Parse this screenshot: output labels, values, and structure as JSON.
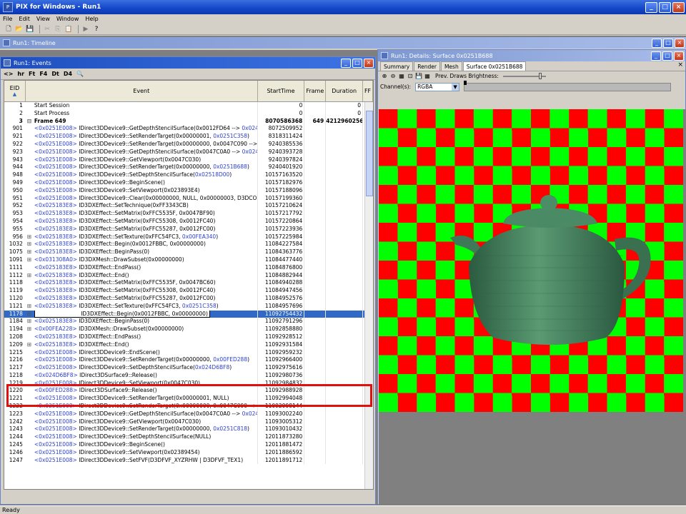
{
  "app": {
    "title": "PIX for Windows - Run1"
  },
  "menu": [
    "File",
    "Edit",
    "View",
    "Window",
    "Help"
  ],
  "timeline": {
    "title": "Run1: Timeline"
  },
  "events_window": {
    "title": "Run1: Events",
    "toolbar": [
      "<>",
      "hr",
      "Ft",
      "F4",
      "Dt",
      "D4"
    ],
    "columns": {
      "eid": "EID",
      "event": "Event",
      "start": "StartTime",
      "frame": "Frame",
      "duration": "Duration",
      "ff": "FF"
    }
  },
  "rows": [
    {
      "eid": "1",
      "ind": "",
      "ptr": "",
      "call": "Start Session",
      "arg": "",
      "arg2": "",
      "start": "0",
      "frame": "",
      "dur": "0"
    },
    {
      "eid": "2",
      "ind": "",
      "ptr": "",
      "call": "Start Process",
      "arg": "",
      "arg2": "",
      "start": "0",
      "frame": "",
      "dur": "0"
    },
    {
      "eid": "3",
      "ind": "⊟",
      "ptr": "",
      "call": "Frame 649",
      "arg": "",
      "arg2": "",
      "start": "8070586368",
      "frame": "649",
      "dur": "4212960256",
      "bold": true
    },
    {
      "eid": "901",
      "ind": "",
      "ptr": "<0x0251E008>",
      "call": " IDirect3DDevice9::GetDepthStencilSurface(0x0012FD64 --> ",
      "arg": "0x024C",
      "arg2": "",
      "start": "8072509952",
      "frame": "",
      "dur": ""
    },
    {
      "eid": "921",
      "ind": "",
      "ptr": "<0x0251E008>",
      "call": " IDirect3DDevice9::SetRenderTarget(0x00000001, ",
      "arg": "0x0251C358",
      "arg2": ")",
      "start": "8318311424",
      "frame": "",
      "dur": ""
    },
    {
      "eid": "922",
      "ind": "",
      "ptr": "<0x0251E008>",
      "call": " IDirect3DDevice9::SetRenderTarget(0x00000000, 0x0047C090 -->",
      "arg": "",
      "arg2": "",
      "start": "9240385536",
      "frame": "",
      "dur": ""
    },
    {
      "eid": "923",
      "ind": "",
      "ptr": "<0x0251E008>",
      "call": " IDirect3DDevice9::GetDepthStencilSurface(0x0047C0A0 --> ",
      "arg": "0x024C",
      "arg2": "",
      "start": "9240393728",
      "frame": "",
      "dur": ""
    },
    {
      "eid": "943",
      "ind": "",
      "ptr": "<0x0251E008>",
      "call": " IDirect3DDevice9::GetViewport(0x0047C030)",
      "arg": "",
      "arg2": "",
      "start": "9240397824",
      "frame": "",
      "dur": ""
    },
    {
      "eid": "944",
      "ind": "",
      "ptr": "<0x0251E008>",
      "call": " IDirect3DDevice9::SetRenderTarget(0x00000000, ",
      "arg": "0x0251B688",
      "arg2": ")",
      "start": "9240401920",
      "frame": "",
      "dur": ""
    },
    {
      "eid": "948",
      "ind": "",
      "ptr": "<0x0251E008>",
      "call": " IDirect3DDevice9::SetDepthStencilSurface(",
      "arg": "0x02518D00",
      "arg2": ")",
      "start": "10157163520",
      "frame": "",
      "dur": ""
    },
    {
      "eid": "949",
      "ind": "",
      "ptr": "<0x0251E008>",
      "call": " IDirect3DDevice9::BeginScene()",
      "arg": "",
      "arg2": "",
      "start": "10157182976",
      "frame": "",
      "dur": ""
    },
    {
      "eid": "950",
      "ind": "",
      "ptr": "<0x0251E008>",
      "call": " IDirect3DDevice9::SetViewport(0x023893E4)",
      "arg": "",
      "arg2": "",
      "start": "10157188096",
      "frame": "",
      "dur": ""
    },
    {
      "eid": "951",
      "ind": "",
      "ptr": "<0x0251E008>",
      "call": " IDirect3DDevice9::Clear(0x00000000, NULL, 0x00000003, D3DCOL",
      "arg": "",
      "arg2": "",
      "start": "10157199360",
      "frame": "",
      "dur": ""
    },
    {
      "eid": "952",
      "ind": "",
      "ptr": "<0x025183E8>",
      "call": " ID3DXEffect::SetTechnique(0xFF3343CB)",
      "arg": "",
      "arg2": "",
      "start": "10157210624",
      "frame": "",
      "dur": ""
    },
    {
      "eid": "953",
      "ind": "",
      "ptr": "<0x025183E8>",
      "call": " ID3DXEffect::SetMatrix(0xFFC5535F, 0x0047BF90)",
      "arg": "",
      "arg2": "",
      "start": "10157217792",
      "frame": "",
      "dur": ""
    },
    {
      "eid": "954",
      "ind": "",
      "ptr": "<0x025183E8>",
      "call": " ID3DXEffect::SetMatrix(0xFFC55308, 0x0012FC40)",
      "arg": "",
      "arg2": "",
      "start": "10157220864",
      "frame": "",
      "dur": ""
    },
    {
      "eid": "955",
      "ind": "",
      "ptr": "<0x025183E8>",
      "call": " ID3DXEffect::SetMatrix(0xFFC55287, 0x0012FC00)",
      "arg": "",
      "arg2": "",
      "start": "10157223936",
      "frame": "",
      "dur": ""
    },
    {
      "eid": "956",
      "ind": "⊞",
      "ptr": "<0x025183E8>",
      "call": " ID3DXEffect::SetTexture(0xFFC54FC3, ",
      "arg": "0x00FEA340",
      "arg2": ")",
      "start": "10157225984",
      "frame": "",
      "dur": ""
    },
    {
      "eid": "1032",
      "ind": "⊞",
      "ptr": "<0x025183E8>",
      "call": " ID3DXEffect::Begin(0x0012FBBC, 0x00000000)",
      "arg": "",
      "arg2": "",
      "start": "11084227584",
      "frame": "",
      "dur": ""
    },
    {
      "eid": "1075",
      "ind": "⊞",
      "ptr": "<0x025183E8>",
      "call": " ID3DXEffect::BeginPass(0)",
      "arg": "",
      "arg2": "",
      "start": "11084363776",
      "frame": "",
      "dur": ""
    },
    {
      "eid": "1091",
      "ind": "⊞",
      "ptr": "<0x031308A0>",
      "call": " ID3DXMesh::DrawSubset(0x00000000)",
      "arg": "",
      "arg2": "",
      "start": "11084477440",
      "frame": "",
      "dur": ""
    },
    {
      "eid": "1111",
      "ind": "",
      "ptr": "<0x025183E8>",
      "call": " ID3DXEffect::EndPass()",
      "arg": "",
      "arg2": "",
      "start": "11084876800",
      "frame": "",
      "dur": ""
    },
    {
      "eid": "1112",
      "ind": "⊞",
      "ptr": "<0x025183E8>",
      "call": " ID3DXEffect::End()",
      "arg": "",
      "arg2": "",
      "start": "11084882944",
      "frame": "",
      "dur": ""
    },
    {
      "eid": "1118",
      "ind": "",
      "ptr": "<0x025183E8>",
      "call": " ID3DXEffect::SetMatrix(0xFFC5535F, 0x0047BC60)",
      "arg": "",
      "arg2": "",
      "start": "11084940288",
      "frame": "",
      "dur": ""
    },
    {
      "eid": "1119",
      "ind": "",
      "ptr": "<0x025183E8>",
      "call": " ID3DXEffect::SetMatrix(0xFFC55308, 0x0012FC40)",
      "arg": "",
      "arg2": "",
      "start": "11084947456",
      "frame": "",
      "dur": ""
    },
    {
      "eid": "1120",
      "ind": "",
      "ptr": "<0x025183E8>",
      "call": " ID3DXEffect::SetMatrix(0xFFC55287, 0x0012FC00)",
      "arg": "",
      "arg2": "",
      "start": "11084952576",
      "frame": "",
      "dur": ""
    },
    {
      "eid": "1121",
      "ind": "⊞",
      "ptr": "<0x025183E8>",
      "call": " ID3DXEffect::SetTexture(0xFFC54FC3, ",
      "arg": "0x0251C358",
      "arg2": ")",
      "start": "11084957696",
      "frame": "",
      "dur": ""
    },
    {
      "eid": "1178",
      "ind": "⊞",
      "ptr": "<0x025183E8>",
      "call": " ID3DXEffect::Begin(0x0012FBBC, 0x00000000)",
      "arg": "",
      "arg2": "",
      "start": "11092754432",
      "frame": "",
      "dur": "",
      "selected": true
    },
    {
      "eid": "1184",
      "ind": "⊞",
      "ptr": "<0x025183E8>",
      "call": " ID3DXEffect::BeginPass(0)",
      "arg": "",
      "arg2": "",
      "start": "11092791296",
      "frame": "",
      "dur": ""
    },
    {
      "eid": "1194",
      "ind": "⊞",
      "ptr": "<0x00FEA228>",
      "call": " ID3DXMesh::DrawSubset(0x00000000)",
      "arg": "",
      "arg2": "",
      "start": "11092858880",
      "frame": "",
      "dur": ""
    },
    {
      "eid": "1208",
      "ind": "",
      "ptr": "<0x025183E8>",
      "call": " ID3DXEffect::EndPass()",
      "arg": "",
      "arg2": "",
      "start": "11092928512",
      "frame": "",
      "dur": ""
    },
    {
      "eid": "1209",
      "ind": "⊞",
      "ptr": "<0x025183E8>",
      "call": " ID3DXEffect::End()",
      "arg": "",
      "arg2": "",
      "start": "11092931584",
      "frame": "",
      "dur": ""
    },
    {
      "eid": "1215",
      "ind": "",
      "ptr": "<0x0251E008>",
      "call": " IDirect3DDevice9::EndScene()",
      "arg": "",
      "arg2": "",
      "start": "11092959232",
      "frame": "",
      "dur": ""
    },
    {
      "eid": "1216",
      "ind": "",
      "ptr": "<0x0251E008>",
      "call": " IDirect3DDevice9::SetRenderTarget(0x00000000, ",
      "arg": "0x00FED288",
      "arg2": ")",
      "start": "11092966400",
      "frame": "",
      "dur": ""
    },
    {
      "eid": "1217",
      "ind": "",
      "ptr": "<0x0251E008>",
      "call": " IDirect3DDevice9::SetDepthStencilSurface(",
      "arg": "0x024D6BF8",
      "arg2": ")",
      "start": "11092975616",
      "frame": "",
      "dur": ""
    },
    {
      "eid": "1218",
      "ind": "",
      "ptr": "<0x024D6BF8>",
      "call": " IDirect3DSurface9::Release()",
      "arg": "",
      "arg2": "",
      "start": "11092980736",
      "frame": "",
      "dur": ""
    },
    {
      "eid": "1219",
      "ind": "",
      "ptr": "<0x0251E008>",
      "call": " IDirect3DDevice9::SetViewport(0x0047C030)",
      "arg": "",
      "arg2": "",
      "start": "11092984832",
      "frame": "",
      "dur": ""
    },
    {
      "eid": "1220",
      "ind": "",
      "ptr": "<0x00FED288>",
      "call": " IDirect3DSurface9::Release()",
      "arg": "",
      "arg2": "",
      "start": "11092988928",
      "frame": "",
      "dur": ""
    },
    {
      "eid": "1221",
      "ind": "",
      "ptr": "<0x0251E008>",
      "call": " IDirect3DDevice9::SetRenderTarget(0x00000001, NULL)",
      "arg": "",
      "arg2": "",
      "start": "11092994048",
      "frame": "",
      "dur": ""
    },
    {
      "eid": "1222",
      "ind": "",
      "ptr": "<0x0251E008>",
      "call": " IDirect3DDevice9::SetRenderTarget(0x00000000, 0x0047C090 -->",
      "arg": "",
      "arg2": "",
      "start": "11092998144",
      "frame": "",
      "dur": ""
    },
    {
      "eid": "1223",
      "ind": "",
      "ptr": "<0x0251E008>",
      "call": " IDirect3DDevice9::GetDepthStencilSurface(0x0047C0A0 --> ",
      "arg": "0x024C",
      "arg2": "",
      "start": "11093002240",
      "frame": "",
      "dur": ""
    },
    {
      "eid": "1242",
      "ind": "",
      "ptr": "<0x0251E008>",
      "call": " IDirect3DDevice9::GetViewport(0x0047C030)",
      "arg": "",
      "arg2": "",
      "start": "11093005312",
      "frame": "",
      "dur": ""
    },
    {
      "eid": "1243",
      "ind": "",
      "ptr": "<0x0251E008>",
      "call": " IDirect3DDevice9::SetRenderTarget(0x00000000, ",
      "arg": "0x0251C818",
      "arg2": ")",
      "start": "11093010432",
      "frame": "",
      "dur": ""
    },
    {
      "eid": "1244",
      "ind": "",
      "ptr": "<0x0251E008>",
      "call": " IDirect3DDevice9::SetDepthStencilSurface(NULL)",
      "arg": "",
      "arg2": "",
      "start": "12011873280",
      "frame": "",
      "dur": ""
    },
    {
      "eid": "1245",
      "ind": "",
      "ptr": "<0x0251E008>",
      "call": " IDirect3DDevice9::BeginScene()",
      "arg": "",
      "arg2": "",
      "start": "12011881472",
      "frame": "",
      "dur": ""
    },
    {
      "eid": "1246",
      "ind": "",
      "ptr": "<0x0251E008>",
      "call": " IDirect3DDevice9::SetViewport(0x02389454)",
      "arg": "",
      "arg2": "",
      "start": "12011886592",
      "frame": "",
      "dur": ""
    },
    {
      "eid": "1247",
      "ind": "",
      "ptr": "<0x0251E008>",
      "call": " IDirect3DDevice9::SetFVF(D3DFVF_XYZRHW | D3DFVF_TEX1)",
      "arg": "",
      "arg2": "",
      "start": "12011891712",
      "frame": "",
      "dur": ""
    }
  ],
  "details_window": {
    "title": "Run1: Details: Surface 0x0251B688",
    "tabs": [
      "Summary",
      "Render",
      "Mesh",
      "Surface 0x0251B688"
    ],
    "brightness_label": "Prev. Draws Brightness:",
    "channel_label": "Channel(s):",
    "channel_value": "RGBA"
  },
  "status": {
    "text": "Ready"
  },
  "colors": {
    "checker_green": "#00ff00",
    "checker_red": "#ff0000",
    "teapot": "#3e7a57",
    "selection": "#3169c6",
    "highlight_box": "#e01010"
  }
}
